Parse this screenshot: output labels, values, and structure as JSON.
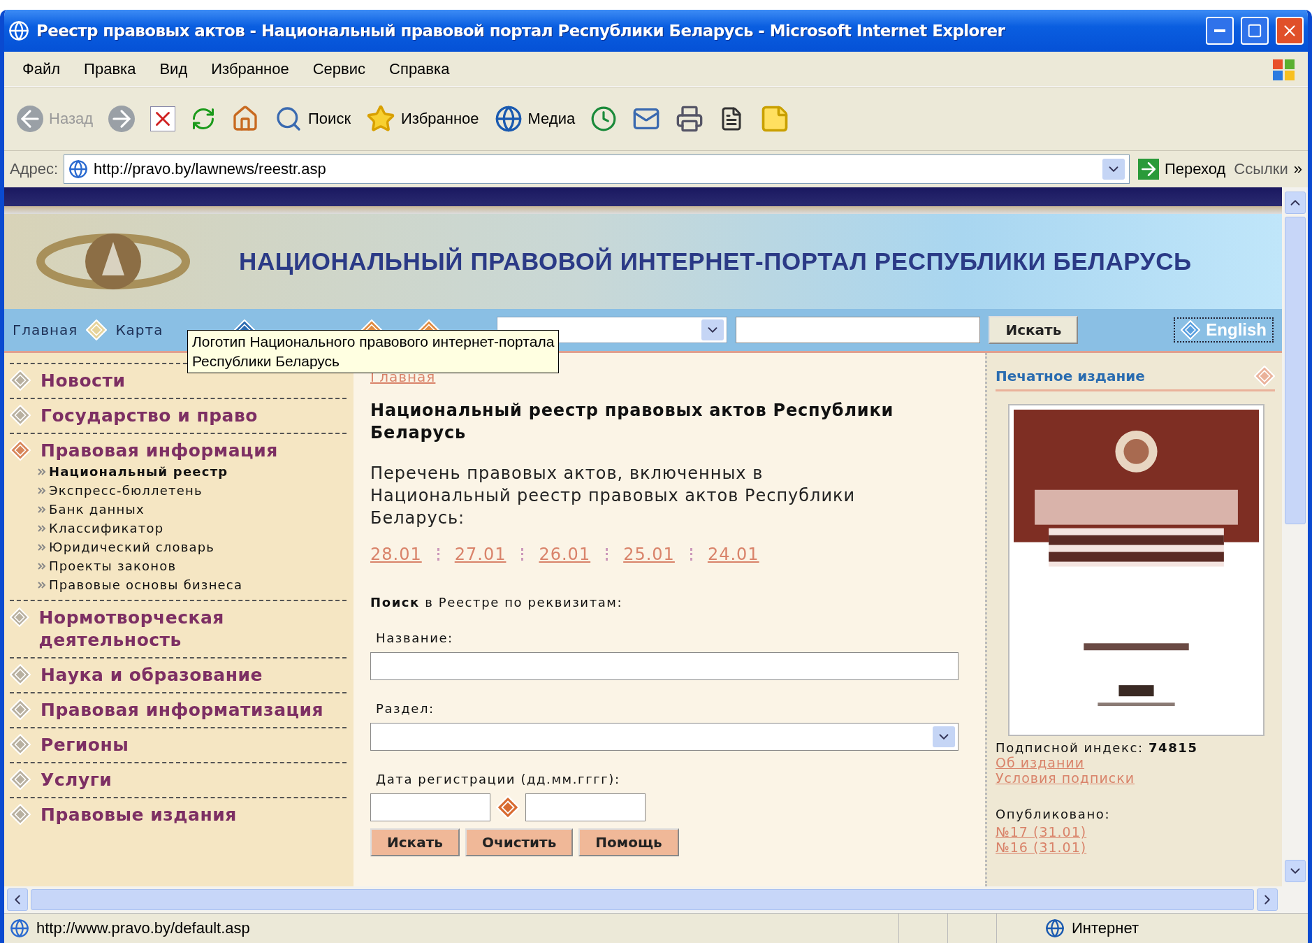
{
  "window": {
    "title": "Реестр правовых актов - Национальный правовой портал Республики Беларусь - Microsoft Internet Explorer"
  },
  "menu": [
    "Файл",
    "Правка",
    "Вид",
    "Избранное",
    "Сервис",
    "Справка"
  ],
  "toolbar": [
    {
      "kind": "back",
      "label": "Назад",
      "disabled": true
    },
    {
      "kind": "forward",
      "disabled": true
    },
    {
      "kind": "stop"
    },
    {
      "kind": "refresh"
    },
    {
      "kind": "home"
    },
    {
      "kind": "search",
      "label": "Поиск"
    },
    {
      "kind": "favorites",
      "label": "Избранное"
    },
    {
      "kind": "media",
      "label": "Медиа"
    },
    {
      "kind": "history"
    },
    {
      "kind": "mail"
    },
    {
      "kind": "print"
    },
    {
      "kind": "edit"
    },
    {
      "kind": "notes"
    }
  ],
  "address": {
    "label": "Адрес:",
    "url": "http://pravo.by/lawnews/reestr.asp",
    "go": "Переход",
    "links": "Ссылки",
    "more": "»"
  },
  "site": {
    "banner_title": "НАЦИОНАЛЬНЫЙ ПРАВОВОЙ ИНТЕРНЕТ-ПОРТАЛ РЕСПУБЛИКИ БЕЛАРУСЬ",
    "nav": [
      "Главная",
      "Карта"
    ],
    "search_button": "Искать",
    "language": "English"
  },
  "tooltip": [
    "Логотип Национального правового интернет-портала",
    "Республики Беларусь"
  ],
  "sidebar": [
    {
      "label": "Новости",
      "selected": false
    },
    {
      "label": "Государство и право",
      "selected": false
    },
    {
      "label": "Правовая информация",
      "selected": true,
      "children": [
        {
          "label": "Национальный реестр",
          "selected": true
        },
        {
          "label": "Экспресс-бюллетень",
          "selected": false
        },
        {
          "label": "Банк данных",
          "selected": false
        },
        {
          "label": "Классификатор",
          "selected": false
        },
        {
          "label": "Юридический словарь",
          "selected": false
        },
        {
          "label": "Проекты законов",
          "selected": false
        },
        {
          "label": "Правовые основы бизнеса",
          "selected": false
        }
      ]
    },
    {
      "label": "Нормотворческая деятельность",
      "selected": false
    },
    {
      "label": "Наука и образование",
      "selected": false
    },
    {
      "label": "Правовая информатизация",
      "selected": false
    },
    {
      "label": "Регионы",
      "selected": false
    },
    {
      "label": "Услуги",
      "selected": false
    },
    {
      "label": "Правовые издания",
      "selected": false
    }
  ],
  "main": {
    "breadcrumb": "Главная",
    "heading": "Национальный реестр правовых актов Республики Беларусь",
    "intro": "Перечень правовых актов, включенных в Национальный реестр правовых актов Республики Беларусь:",
    "dates": [
      "28.01",
      "27.01",
      "26.01",
      "25.01",
      "24.01"
    ],
    "search_title": "**Поиск** в Реестре по реквизитам:",
    "fields": [
      {
        "kind": "text",
        "label": "Название:"
      },
      {
        "kind": "select",
        "label": "Раздел:"
      },
      {
        "kind": "date_range",
        "label": "Дата регистрации (дд.мм.гггг):"
      }
    ],
    "buttons": [
      "Искать",
      "Очистить",
      "Помощь"
    ]
  },
  "aside": {
    "title": "Печатное издание",
    "index": "Подписной индекс: **74815**",
    "links": [
      "Об издании",
      "Условия подписки"
    ],
    "published_label": "Опубликовано:",
    "issues": [
      "№17 (31.01)",
      "№16 (31.01)"
    ]
  },
  "status_bar": {
    "url": "http://www.pravo.by/default.asp",
    "zone": "Интернет"
  }
}
